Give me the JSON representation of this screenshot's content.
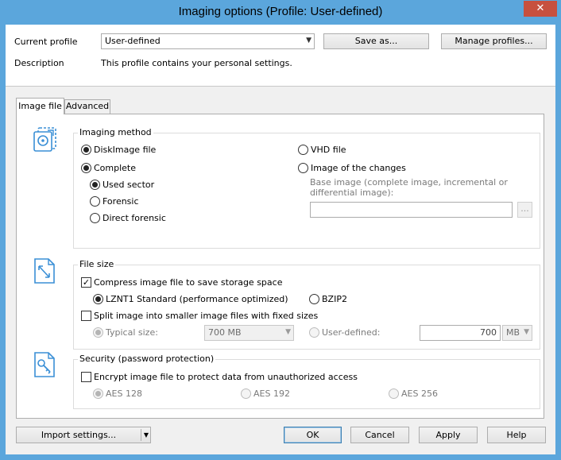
{
  "window": {
    "title": "Imaging options (Profile: User-defined)",
    "close_glyph": "✕"
  },
  "profile": {
    "current_label": "Current profile",
    "current_value": "User-defined",
    "save_as_label": "Save as...",
    "manage_label": "Manage profiles...",
    "description_label": "Description",
    "description_text": "This profile contains your personal settings."
  },
  "tabs": [
    {
      "label": "Image file",
      "active": true
    },
    {
      "label": "Advanced",
      "active": false
    }
  ],
  "imaging_method": {
    "title": "Imaging method",
    "diskimage": "DiskImage file",
    "vhd": "VHD file",
    "complete": "Complete",
    "changes": "Image of the changes",
    "used_sector": "Used sector",
    "forensic": "Forensic",
    "direct_forensic": "Direct forensic",
    "base_image_hint": "Base image (complete image, incremental or differential image):",
    "browse_label": "..."
  },
  "file_size": {
    "title": "File size",
    "compress": "Compress image file to save storage space",
    "lznt1": "LZNT1 Standard (performance optimized)",
    "bzip2": "BZIP2",
    "split": "Split image into smaller image files with fixed sizes",
    "typical_label": "Typical size:",
    "typical_value": "700 MB",
    "user_defined_label": "User-defined:",
    "user_defined_value": "700",
    "unit_value": "MB"
  },
  "security": {
    "title": "Security (password protection)",
    "encrypt": "Encrypt image file to protect data from unauthorized access",
    "aes128": "AES 128",
    "aes192": "AES 192",
    "aes256": "AES 256"
  },
  "footer": {
    "import_label": "Import settings...",
    "ok_label": "OK",
    "cancel_label": "Cancel",
    "apply_label": "Apply",
    "help_label": "Help"
  },
  "icons": {
    "imaging": "disk-image-icon",
    "file_size": "resize-arrow-icon",
    "security": "security-key-icon"
  },
  "colors": {
    "titlebar": "#5ba6dc",
    "close": "#c7503f",
    "icon_blue": "#3a8fd6"
  }
}
